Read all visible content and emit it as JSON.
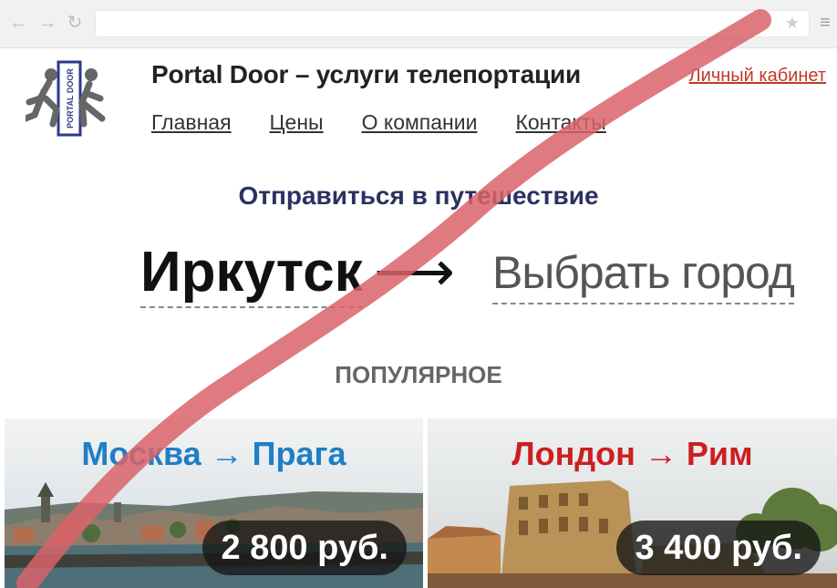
{
  "browser": {
    "back_icon": "←",
    "forward_icon": "→",
    "reload_icon": "↻",
    "star_icon": "★",
    "menu_icon": "≡"
  },
  "header": {
    "logo_text": "PORTAL DOOR",
    "title": "Portal Door – услуги телепортации",
    "account_link": "Личный кабинет",
    "nav": [
      "Главная",
      "Цены",
      "О компании",
      "Контакты"
    ]
  },
  "main": {
    "section_title": "Отправиться в путешествие",
    "from_city": "Иркутск",
    "arrow": "⟶",
    "to_placeholder": "Выбрать город",
    "popular_label": "ПОПУЛЯРНОЕ"
  },
  "cards": [
    {
      "title": "Москва → Прага",
      "price": "2 800 руб.",
      "title_color": "#1f7fc4"
    },
    {
      "title": "Лондон → Рим",
      "price": "3 400 руб.",
      "title_color": "#cc1f1f"
    }
  ],
  "colors": {
    "accent_red": "#c0392b",
    "title_blue": "#2b3161",
    "stroke": "#d9636a"
  }
}
